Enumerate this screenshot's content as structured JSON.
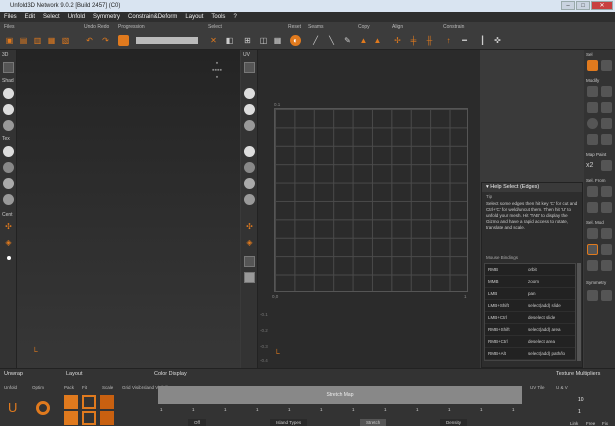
{
  "window": {
    "title": "Unfold3D Network 9.0.2 [Build 2457] (C0)",
    "min": "–",
    "max": "□",
    "close": "✕"
  },
  "menu": [
    "Files",
    "Edit",
    "Select",
    "Unfold",
    "Symmetry",
    "Constrain&Deform",
    "Layout",
    "Tools",
    "?"
  ],
  "toolbar": {
    "files": "Files",
    "undo_redo": "Undo Redo",
    "progression": "Progression",
    "select": "Select",
    "reset": "Reset",
    "seams": "Seams",
    "copy": "Copy",
    "align": "Align",
    "constrain": "Constrain"
  },
  "left_strip": {
    "sel_3d": "3D",
    "shad": "Shad",
    "tex": "Tex",
    "cent": "Cent"
  },
  "uv_strip": {
    "uv": "UV"
  },
  "uv_view": {
    "top_left": "0.1",
    "bottom_left": "0,0",
    "bottom_right": "1",
    "y_labels": [
      "-0.1",
      "-0.2",
      "-0.3",
      "-0.4"
    ]
  },
  "help": {
    "title": "Help Select (Edges)",
    "tip_label": "Tip",
    "tip": "Select some edges then hit key 'C' for cut and Ctrl+'C' for weld/uncut them. Then hit 'U' to unfold your mesh. Hit 'TAB' to display the Gizmo and have a rapid access to rotate, translate and scale.",
    "bindings_label": "Mouse Bindings",
    "bindings": [
      [
        "RMB",
        "orbit"
      ],
      [
        "MMB",
        "zoom"
      ],
      [
        "LMB",
        "pan"
      ],
      [
        "LMB+Shift",
        "select(add) slide"
      ],
      [
        "LMB+Ctrl",
        "deselect slide"
      ],
      [
        "RMB+Shift",
        "select(add) area"
      ],
      [
        "RMB+Ctrl",
        "deselect area"
      ],
      [
        "RMB+Alt",
        "select(add) path/lo"
      ]
    ]
  },
  "right_panel": {
    "sel": "Sel",
    "modify": "Modify",
    "map_paint": "Map Paint",
    "x2": "x2",
    "sel_from": "Sel. From",
    "sel_mod": "Sel. Mod",
    "symmetry": "Symmetry"
  },
  "bottom": {
    "unwrap": "Unwrap",
    "unfold": "Unfold",
    "optim": "Optim",
    "layout": "Layout",
    "pack": "Pack",
    "fit": "Fit",
    "scale": "Scale",
    "grid": "Grid",
    "vis": "Visib",
    "island_vis": "Island Visibility",
    "color_display": "Color Display",
    "stretch_map": "Stretch Map",
    "ticks": [
      "1",
      "1",
      "1",
      "1",
      "1",
      "1",
      "1",
      "1",
      "1",
      "1",
      "1",
      "1"
    ],
    "tabs": [
      "Off",
      "Island Types",
      "Stretch",
      "Density"
    ],
    "uv_tile": "UV Tile",
    "texture_multipliers": "Texture Multipliers",
    "uv_v": "U & V",
    "val_10": "10",
    "val_1": "1",
    "link": "Link",
    "free": "Free",
    "fix": "Fix"
  }
}
